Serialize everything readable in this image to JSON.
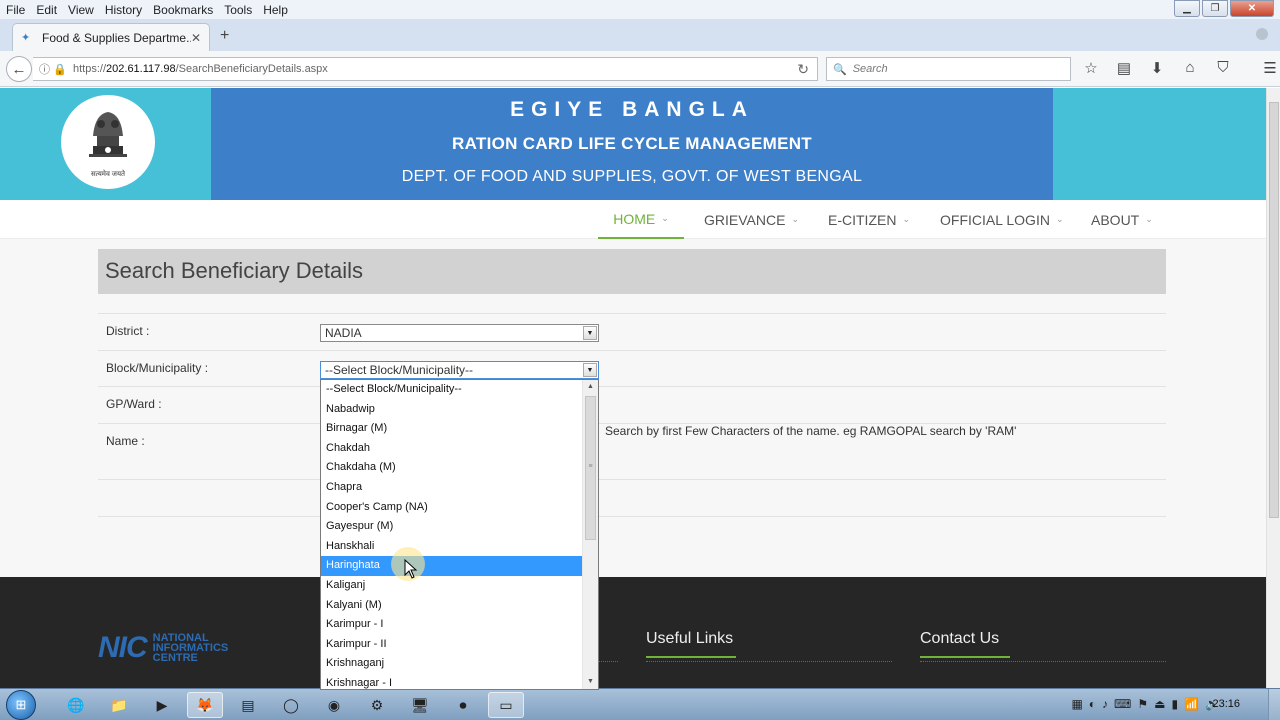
{
  "browser": {
    "menu": [
      "File",
      "Edit",
      "View",
      "History",
      "Bookmarks",
      "Tools",
      "Help"
    ],
    "tab_title": "Food & Supplies Departme...",
    "url_prefix": "https://",
    "url_host": "202.61.117.98",
    "url_path": "/SearchBeneficiaryDetails.aspx",
    "search_placeholder": "Search"
  },
  "banner": {
    "line1": "EGIYE BANGLA",
    "line2": "RATION CARD LIFE CYCLE MANAGEMENT",
    "line3": "DEPT. OF FOOD AND SUPPLIES, GOVT. OF WEST BENGAL"
  },
  "nav": {
    "items": [
      {
        "label": "HOME",
        "active": true
      },
      {
        "label": "GRIEVANCE"
      },
      {
        "label": "E-CITIZEN"
      },
      {
        "label": "OFFICIAL LOGIN"
      },
      {
        "label": "ABOUT"
      }
    ]
  },
  "form": {
    "title": "Search Beneficiary Details",
    "district_label": "District :",
    "district_value": "NADIA",
    "block_label": "Block/Municipality :",
    "block_value": "--Select Block/Municipality--",
    "gp_label": "GP/Ward :",
    "name_label": "Name :",
    "name_hint": "Search by first Few Characters of the name. eg RAMGOPAL search by 'RAM'"
  },
  "dropdown": {
    "options": [
      "--Select Block/Municipality--",
      "Nabadwip",
      "Birnagar (M)",
      "Chakdah",
      "Chakdaha (M)",
      "Chapra",
      "Cooper's Camp (NA)",
      "Gayespur (M)",
      "Hanskhali",
      "Haringhata",
      "Kaliganj",
      "Kalyani (M)",
      "Karimpur - I",
      "Karimpur - II",
      "Krishnaganj",
      "Krishnagar - I"
    ],
    "highlighted": "Haringhata"
  },
  "footer": {
    "nic_big": "NIC",
    "nic_small_1": "NATIONAL",
    "nic_small_2": "INFORMATICS",
    "nic_small_3": "CENTRE",
    "useful_links": "Useful Links",
    "contact_us": "Contact Us"
  },
  "emblem_caption": "सत्यमेव जयते",
  "taskbar": {
    "clock": "23:16"
  }
}
